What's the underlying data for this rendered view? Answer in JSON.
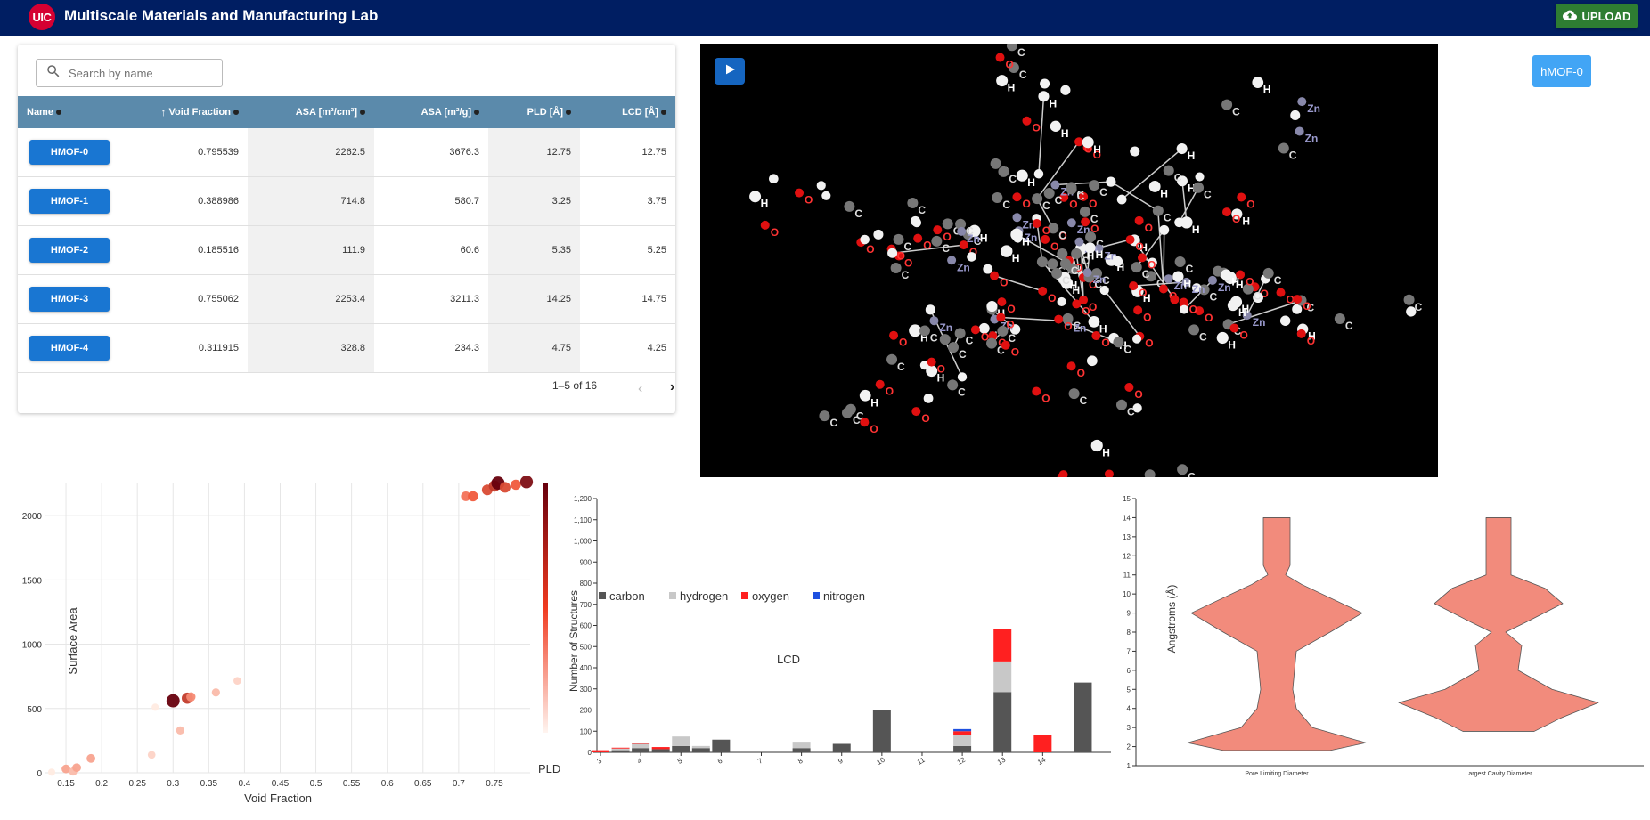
{
  "header": {
    "logo_text": "UIC",
    "title": "Multiscale Materials and Manufacturing Lab",
    "upload_label": "UPLOAD",
    "upload_icon": "cloud-upload-icon",
    "background_color": "#001e62",
    "upload_color": "#2e7d32"
  },
  "table": {
    "search_placeholder": "Search by name",
    "search_icon": "search-icon",
    "columns": [
      "Name",
      "Void Fraction",
      "ASA [m²/cm³]",
      "ASA [m²/g]",
      "PLD [Å]",
      "LCD [Å]"
    ],
    "sort_icon": "arrow-up-icon",
    "rows": [
      {
        "name": "HMOF-0",
        "void": "0.795539",
        "asa_cm3": "2262.5",
        "asa_g": "3676.3",
        "pld": "12.75",
        "lcd": "12.75"
      },
      {
        "name": "HMOF-1",
        "void": "0.388986",
        "asa_cm3": "714.8",
        "asa_g": "580.7",
        "pld": "3.25",
        "lcd": "3.75"
      },
      {
        "name": "HMOF-2",
        "void": "0.185516",
        "asa_cm3": "111.9",
        "asa_g": "60.6",
        "pld": "5.35",
        "lcd": "5.25"
      },
      {
        "name": "HMOF-3",
        "void": "0.755062",
        "asa_cm3": "2253.4",
        "asa_g": "3211.3",
        "pld": "14.25",
        "lcd": "14.75"
      },
      {
        "name": "HMOF-4",
        "void": "0.311915",
        "asa_cm3": "328.8",
        "asa_g": "234.3",
        "pld": "4.75",
        "lcd": "4.25"
      }
    ],
    "pagination": "1–5 of 16",
    "header_color": "#5b8aab",
    "button_color": "#1976d2"
  },
  "viewer": {
    "play_icon": "play-icon",
    "selected_mof": "hMOF-0",
    "atom_labels": [
      "H",
      "C",
      "O",
      "Zn"
    ]
  },
  "chart_data": [
    {
      "type": "scatter",
      "xlabel": "Void Fraction",
      "ylabel": "Surface Area",
      "color_label": "PLD",
      "x_ticks": [
        "0.15",
        "0.2",
        "0.25",
        "0.3",
        "0.35",
        "0.4",
        "0.45",
        "0.5",
        "0.55",
        "0.6",
        "0.65",
        "0.7",
        "0.75"
      ],
      "y_ticks": [
        "0",
        "500",
        "1000",
        "1500",
        "2000"
      ],
      "xlim": [
        0.12,
        0.8
      ],
      "ylim": [
        0,
        2250
      ],
      "grid": true,
      "points": [
        {
          "x": 0.13,
          "y": 5,
          "pld": 2
        },
        {
          "x": 0.15,
          "y": 30,
          "pld": 5
        },
        {
          "x": 0.16,
          "y": 10,
          "pld": 4
        },
        {
          "x": 0.165,
          "y": 40,
          "pld": 5
        },
        {
          "x": 0.185,
          "y": 112,
          "pld": 5
        },
        {
          "x": 0.27,
          "y": 140,
          "pld": 3
        },
        {
          "x": 0.275,
          "y": 510,
          "pld": 2
        },
        {
          "x": 0.3,
          "y": 560,
          "pld": 14
        },
        {
          "x": 0.31,
          "y": 330,
          "pld": 4
        },
        {
          "x": 0.32,
          "y": 580,
          "pld": 10
        },
        {
          "x": 0.325,
          "y": 590,
          "pld": 6
        },
        {
          "x": 0.36,
          "y": 625,
          "pld": 4
        },
        {
          "x": 0.39,
          "y": 715,
          "pld": 3
        },
        {
          "x": 0.71,
          "y": 2150,
          "pld": 7
        },
        {
          "x": 0.72,
          "y": 2150,
          "pld": 8
        },
        {
          "x": 0.74,
          "y": 2200,
          "pld": 9
        },
        {
          "x": 0.75,
          "y": 2230,
          "pld": 10
        },
        {
          "x": 0.755,
          "y": 2253,
          "pld": 14
        },
        {
          "x": 0.765,
          "y": 2220,
          "pld": 9
        },
        {
          "x": 0.78,
          "y": 2240,
          "pld": 8
        },
        {
          "x": 0.795,
          "y": 2262,
          "pld": 13
        }
      ]
    },
    {
      "type": "bar",
      "ylabel": "Number of Structures",
      "xlabel": "LCD",
      "legend": [
        "carbon",
        "hydrogen",
        "oxygen",
        "nitrogen"
      ],
      "legend_colors": [
        "#555555",
        "#c8c8c8",
        "#ff2020",
        "#1e50e0"
      ],
      "y_ticks": [
        "0",
        "100",
        "200",
        "300",
        "400",
        "500",
        "600",
        "700",
        "800",
        "900",
        "1,000",
        "1,100",
        "1,200"
      ],
      "ylim": [
        0,
        1200
      ],
      "bars": [
        {
          "x": "3",
          "carbon": 0,
          "hydrogen": 0,
          "oxygen": 10,
          "nitrogen": 0
        },
        {
          "x": "3.5",
          "carbon": 10,
          "hydrogen": 8,
          "oxygen": 4,
          "nitrogen": 0
        },
        {
          "x": "4",
          "carbon": 20,
          "hydrogen": 20,
          "oxygen": 5,
          "nitrogen": 0
        },
        {
          "x": "4.5",
          "carbon": 15,
          "hydrogen": 0,
          "oxygen": 10,
          "nitrogen": 0
        },
        {
          "x": "5",
          "carbon": 30,
          "hydrogen": 45,
          "oxygen": 0,
          "nitrogen": 0
        },
        {
          "x": "5.5",
          "carbon": 20,
          "hydrogen": 10,
          "oxygen": 0,
          "nitrogen": 0
        },
        {
          "x": "6",
          "carbon": 60,
          "hydrogen": 0,
          "oxygen": 0,
          "nitrogen": 0
        },
        {
          "x": "8",
          "carbon": 20,
          "hydrogen": 30,
          "oxygen": 0,
          "nitrogen": 0
        },
        {
          "x": "9",
          "carbon": 40,
          "hydrogen": 0,
          "oxygen": 0,
          "nitrogen": 0
        },
        {
          "x": "10",
          "carbon": 200,
          "hydrogen": 0,
          "oxygen": 0,
          "nitrogen": 0
        },
        {
          "x": "12",
          "carbon": 30,
          "hydrogen": 50,
          "oxygen": 20,
          "nitrogen": 10
        },
        {
          "x": "13",
          "carbon": 285,
          "hydrogen": 145,
          "oxygen": 155,
          "nitrogen": 0
        },
        {
          "x": "14",
          "carbon": 0,
          "hydrogen": 0,
          "oxygen": 80,
          "nitrogen": 0
        },
        {
          "x": "15",
          "carbon": 330,
          "hydrogen": 0,
          "oxygen": 0,
          "nitrogen": 0
        }
      ],
      "x_ticks": [
        "3",
        "4",
        "5",
        "6",
        "7",
        "8",
        "9",
        "10",
        "11",
        "12",
        "13",
        "14"
      ]
    },
    {
      "type": "violin",
      "ylabel": "Angstroms (Å)",
      "categories": [
        "Pore Limiting Diameter",
        "Largest Cavity Diameter"
      ],
      "y_ticks": [
        "1",
        "2",
        "3",
        "4",
        "5",
        "6",
        "7",
        "8",
        "9",
        "10",
        "11",
        "12",
        "13",
        "14",
        "15"
      ],
      "ylim": [
        1,
        15
      ],
      "fill_color": "#f28b7c"
    }
  ]
}
